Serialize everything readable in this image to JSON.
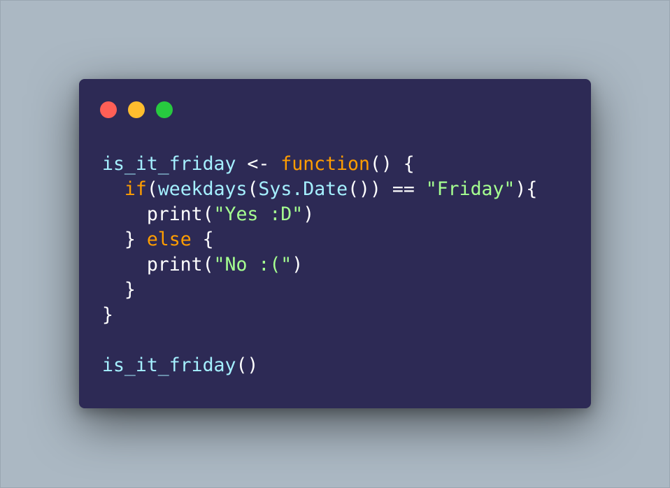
{
  "window": {
    "controls": [
      {
        "name": "close",
        "color": "#ff5f56"
      },
      {
        "name": "minimize",
        "color": "#ffbd2e"
      },
      {
        "name": "maximize",
        "color": "#27c93f"
      }
    ]
  },
  "colors": {
    "background": "#abb8c3",
    "editor_bg": "#2d2a55",
    "identifier": "#a5f0ff",
    "keyword": "#ff9d00",
    "string": "#a5ff90",
    "plain": "#ffffff"
  },
  "code": {
    "lines": [
      [
        {
          "t": "is_it_friday",
          "k": "ident"
        },
        {
          "t": " <- ",
          "k": "plain"
        },
        {
          "t": "function",
          "k": "kw"
        },
        {
          "t": "() {",
          "k": "plain"
        }
      ],
      [
        {
          "t": "  ",
          "k": "plain"
        },
        {
          "t": "if",
          "k": "kw"
        },
        {
          "t": "(",
          "k": "plain"
        },
        {
          "t": "weekdays",
          "k": "ident"
        },
        {
          "t": "(",
          "k": "plain"
        },
        {
          "t": "Sys.Date",
          "k": "ident"
        },
        {
          "t": "()) == ",
          "k": "plain"
        },
        {
          "t": "\"Friday\"",
          "k": "str"
        },
        {
          "t": "){",
          "k": "plain"
        }
      ],
      [
        {
          "t": "    print(",
          "k": "plain"
        },
        {
          "t": "\"Yes :D\"",
          "k": "str"
        },
        {
          "t": ")",
          "k": "plain"
        }
      ],
      [
        {
          "t": "  } ",
          "k": "plain"
        },
        {
          "t": "else",
          "k": "kw"
        },
        {
          "t": " {",
          "k": "plain"
        }
      ],
      [
        {
          "t": "    print(",
          "k": "plain"
        },
        {
          "t": "\"No :(\"",
          "k": "str"
        },
        {
          "t": ")",
          "k": "plain"
        }
      ],
      [
        {
          "t": "  }",
          "k": "plain"
        }
      ],
      [
        {
          "t": "}",
          "k": "plain"
        }
      ],
      [],
      [
        {
          "t": "is_it_friday",
          "k": "ident"
        },
        {
          "t": "()",
          "k": "plain"
        }
      ]
    ]
  }
}
